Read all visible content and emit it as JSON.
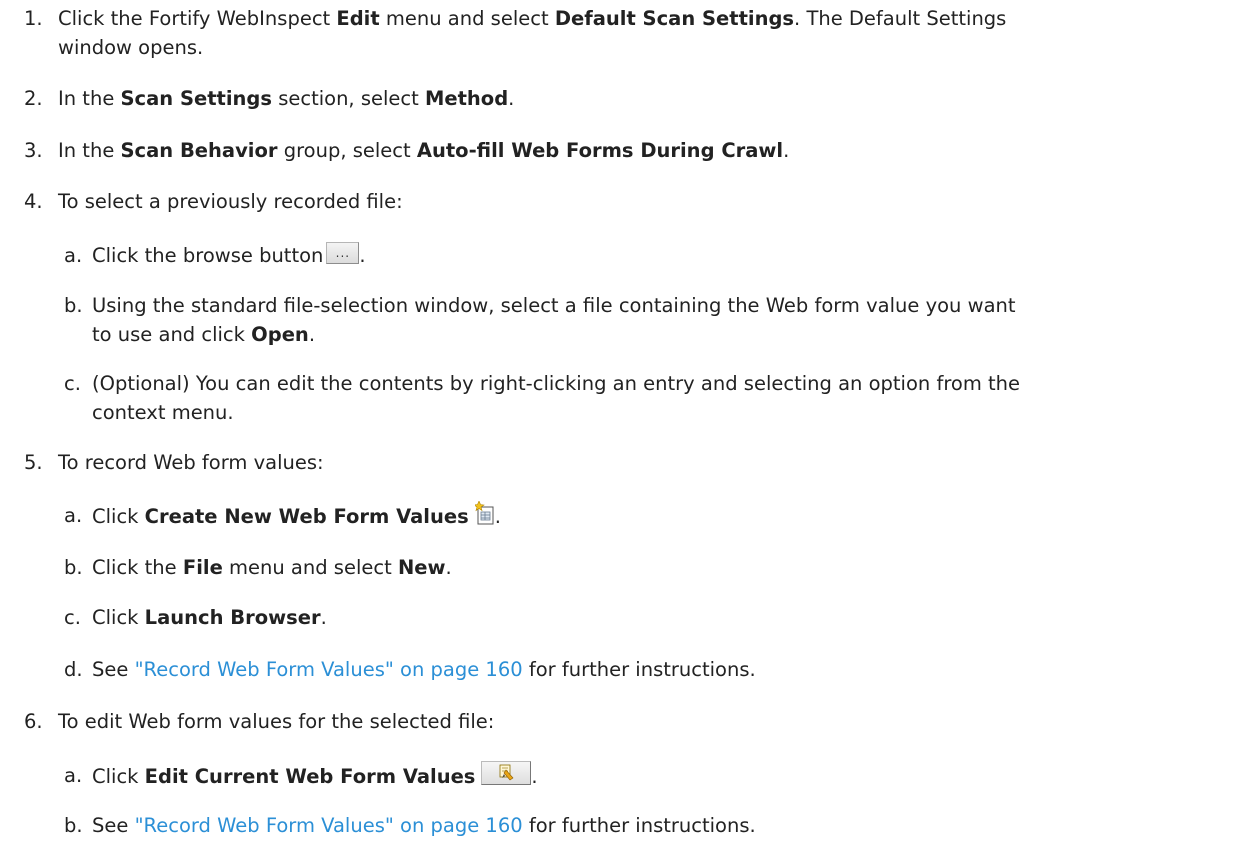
{
  "steps": [
    {
      "num": "1.",
      "parts": [
        "Click the Fortify WebInspect ",
        "Edit",
        " menu and select ",
        "Default Scan Settings",
        ". The Default Settings",
        "window opens."
      ]
    },
    {
      "num": "2.",
      "parts": [
        "In the ",
        "Scan Settings",
        " section, select ",
        "Method",
        "."
      ]
    },
    {
      "num": "3.",
      "parts": [
        "In the ",
        "Scan Behavior",
        " group, select ",
        "Auto-fill Web Forms During Crawl",
        "."
      ]
    },
    {
      "num": "4.",
      "text": "To select a previously recorded file:",
      "subs": [
        {
          "num": "a.",
          "parts": [
            "Click the browse button",
            "."
          ],
          "icon_name": "browse-button-icon",
          "icon_glyph": "..."
        },
        {
          "num": "b.",
          "parts": [
            "Using the standard file-selection window, select a file containing the Web form value you want",
            "to use and click ",
            "Open",
            "."
          ]
        },
        {
          "num": "c.",
          "parts": [
            "(Optional) You can edit the contents by right-clicking an entry and selecting an option from the",
            "context menu."
          ]
        }
      ]
    },
    {
      "num": "5.",
      "text": "To record Web form values:",
      "subs": [
        {
          "num": "a.",
          "parts": [
            "Click ",
            "Create New Web Form Values",
            "."
          ],
          "icon_name": "create-new-web-form-values-icon"
        },
        {
          "num": "b.",
          "parts": [
            "Click the ",
            "File",
            " menu and select ",
            "New",
            "."
          ]
        },
        {
          "num": "c.",
          "parts": [
            "Click ",
            "Launch Browser",
            "."
          ]
        },
        {
          "num": "d.",
          "parts": [
            "See ",
            "\"Record Web Form Values\" on page 160",
            " for further instructions."
          ]
        }
      ]
    },
    {
      "num": "6.",
      "text": "To edit Web form values for the selected file:",
      "subs": [
        {
          "num": "a.",
          "parts": [
            "Click ",
            "Edit Current Web Form Values",
            "."
          ],
          "icon_name": "edit-current-web-form-values-icon"
        },
        {
          "num": "b.",
          "parts": [
            "See ",
            "\"Record Web Form Values\" on page 160",
            " for further instructions."
          ]
        }
      ]
    }
  ],
  "colors": {
    "text": "#222222",
    "link": "#2b8fd6"
  }
}
